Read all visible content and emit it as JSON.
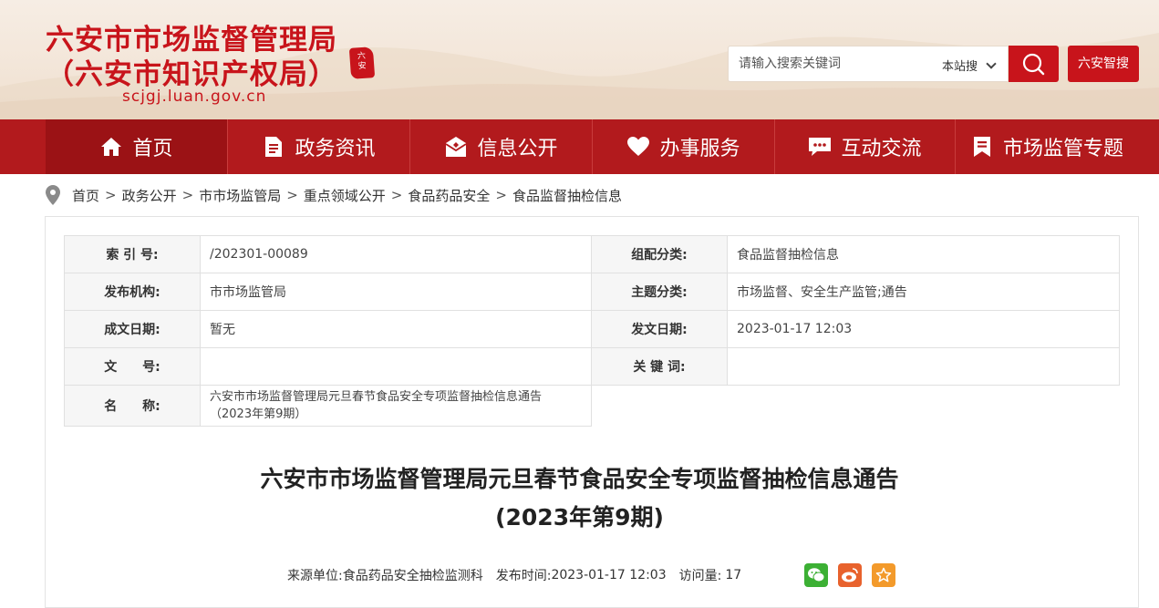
{
  "header": {
    "title_line1": "六安市市场监督管理局",
    "title_line2": "（六安市知识产权局）",
    "domain": "scjgj.luan.gov.cn",
    "seal_text": "六安市",
    "search_placeholder": "请输入搜索关键词",
    "search_scope": "本站搜",
    "smart_search": "六安智搜"
  },
  "nav": [
    {
      "label": "首页",
      "icon": "home-icon"
    },
    {
      "label": "政务资讯",
      "icon": "document-icon"
    },
    {
      "label": "信息公开",
      "icon": "open-letter-icon"
    },
    {
      "label": "办事服务",
      "icon": "heart-icon"
    },
    {
      "label": "互动交流",
      "icon": "chat-icon"
    },
    {
      "label": "市场监管专题",
      "icon": "bookmark-icon"
    }
  ],
  "breadcrumb": [
    "首页",
    "政务公开",
    "市市场监管局",
    "重点领域公开",
    "食品药品安全",
    "食品监督抽检信息"
  ],
  "meta": {
    "index_key": "索 引 号:",
    "index_val": "/202301-00089",
    "category_key": "组配分类:",
    "category_val": "食品监督抽检信息",
    "publisher_key": "发布机构:",
    "publisher_val": "市市场监管局",
    "topic_key": "主题分类:",
    "topic_val": "市场监督、安全生产监管;通告",
    "created_key": "成文日期:",
    "created_val": "暂无",
    "issued_key": "发文日期:",
    "issued_val": "2023-01-17 12:03",
    "docno_key": "文　　号:",
    "docno_val": "",
    "keywords_key": "关 键 词:",
    "keywords_val": "",
    "name_key": "名　　称:",
    "name_val_line1": "六安市市场监督管理局元旦春节食品安全专项监督抽检信息通告",
    "name_val_line2": "（2023年第9期）"
  },
  "article": {
    "title_line1": "六安市市场监督管理局元旦春节食品安全专项监督抽检信息通告",
    "title_line2": "(2023年第9期)",
    "source_label": "来源单位:",
    "source_value": "食品药品安全抽检监测科",
    "time_label": "发布时间:",
    "time_value": "2023-01-17 12:03",
    "views_label": "访问量:",
    "views_value": "17"
  },
  "colors": {
    "brand_red": "#c8141b",
    "nav_red": "#b21a1d",
    "wechat_green": "#3cb034",
    "weibo_orange": "#e8622d",
    "favorite_orange": "#f39a2b"
  }
}
